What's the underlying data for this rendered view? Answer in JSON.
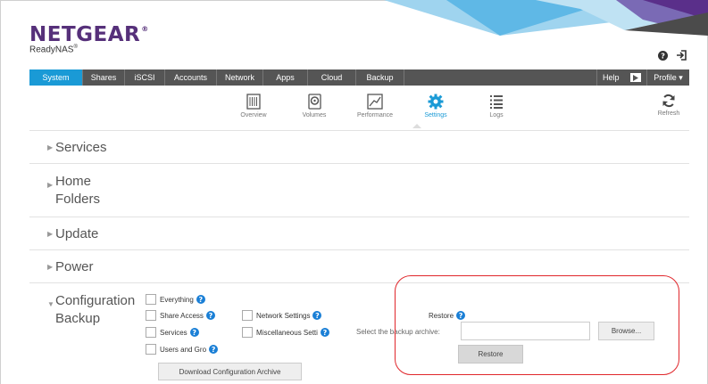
{
  "brand": {
    "logo": "NETGEAR",
    "trademark": "®",
    "product": "ReadyNAS",
    "product_trademark": "®"
  },
  "top_icons": {
    "help": "help-circle-icon",
    "logout": "logout-icon"
  },
  "nav": {
    "tabs": [
      {
        "label": "System",
        "active": true
      },
      {
        "label": "Shares"
      },
      {
        "label": "iSCSI"
      },
      {
        "label": "Accounts"
      },
      {
        "label": "Network"
      },
      {
        "label": "Apps"
      },
      {
        "label": "Cloud"
      },
      {
        "label": "Backup"
      }
    ],
    "help": "Help",
    "profile": "Profile ▾"
  },
  "subnav": {
    "items": [
      {
        "label": "Overview",
        "icon": "overview-icon"
      },
      {
        "label": "Volumes",
        "icon": "volumes-icon"
      },
      {
        "label": "Performance",
        "icon": "performance-icon"
      },
      {
        "label": "Settings",
        "icon": "gear-icon",
        "active": true
      },
      {
        "label": "Logs",
        "icon": "logs-icon"
      }
    ],
    "refresh": "Refresh"
  },
  "sections": {
    "services": "Services",
    "home_folders_1": "Home",
    "home_folders_2": "Folders",
    "update": "Update",
    "power": "Power",
    "config_1": "Configuration",
    "config_2": "Backup"
  },
  "config": {
    "everything": "Everything",
    "share_access": "Share Access",
    "services": "Services",
    "users_and_groups": "Users and Gro",
    "network_settings": "Network Settings",
    "misc_settings": "Miscellaneous Setti",
    "download_button": "Download Configuration Archive"
  },
  "restore": {
    "title": "Restore",
    "select_label": "Select the backup archive:",
    "file_value": "",
    "browse": "Browse...",
    "restore_button": "Restore"
  },
  "colors": {
    "accent": "#1a9ad6",
    "brand": "#56307a",
    "nav_bg": "#555555",
    "highlight": "#e0262b"
  }
}
